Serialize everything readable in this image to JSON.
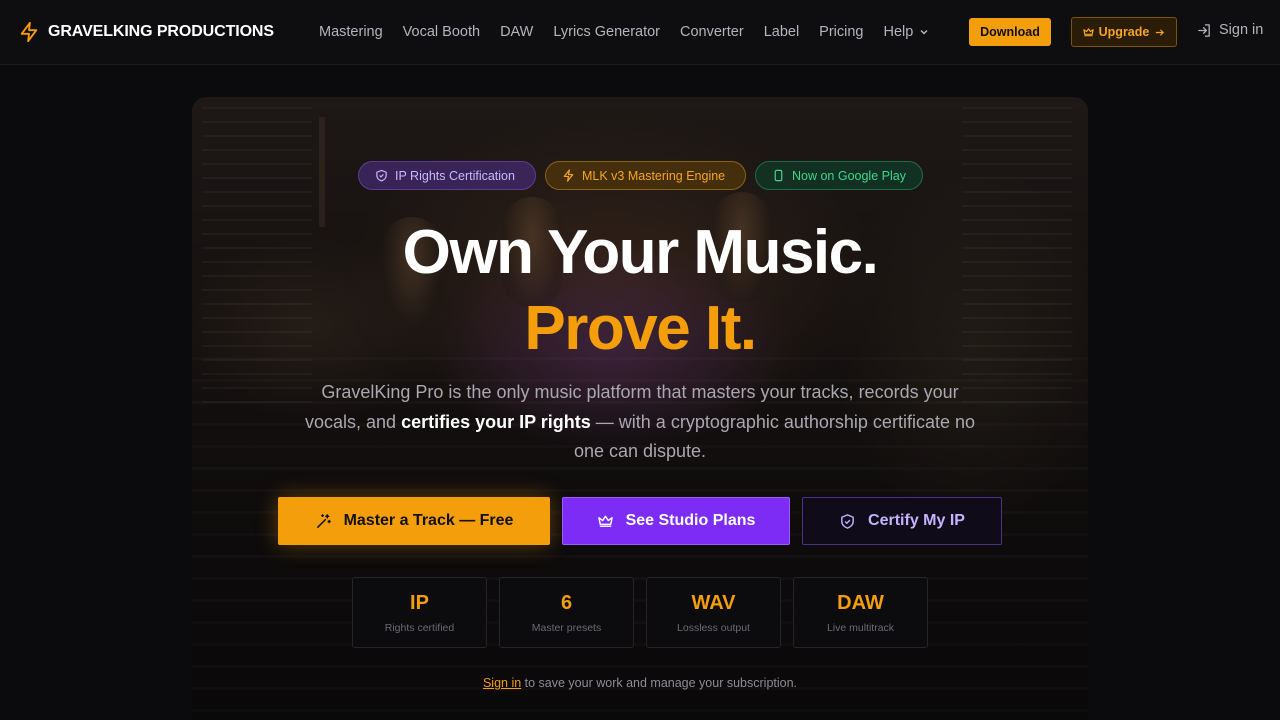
{
  "brand": {
    "name": "GRAVELKING PRODUCTIONS",
    "icon": "lightning-bolt-icon",
    "accent": "#f59e0b"
  },
  "nav": {
    "items": [
      {
        "label": "Mastering"
      },
      {
        "label": "Vocal Booth"
      },
      {
        "label": "DAW"
      },
      {
        "label": "Lyrics Generator"
      },
      {
        "label": "Converter"
      },
      {
        "label": "Label"
      },
      {
        "label": "Pricing"
      },
      {
        "label": "Help"
      }
    ],
    "download_label": "Download",
    "upgrade_label": "Upgrade",
    "signin_label": "Sign in"
  },
  "badges": [
    {
      "label": "IP Rights Certification",
      "icon": "shield-icon",
      "color": "#c9b8ff"
    },
    {
      "label": "MLK v3 Mastering Engine",
      "icon": "lightning-bolt-icon",
      "color": "#f5a524"
    },
    {
      "label": "Now on Google Play",
      "icon": "phone-icon",
      "color": "#3dd68c"
    }
  ],
  "hero": {
    "headline_1": "Own Your Music.",
    "headline_2": "Prove It.",
    "lead_1": "GravelKing Pro is the only music platform that masters your tracks, records your vocals, and ",
    "lead_bold": "certifies your IP rights",
    "lead_2": " — with a cryptographic authorship certificate no one can dispute."
  },
  "cta": {
    "master_label": "Master a Track — Free",
    "plans_label": "See Studio Plans",
    "certify_label": "Certify My IP"
  },
  "stats": [
    {
      "value": "IP",
      "label": "Rights certified"
    },
    {
      "value": "6",
      "label": "Master presets"
    },
    {
      "value": "WAV",
      "label": "Lossless output"
    },
    {
      "value": "DAW",
      "label": "Live multitrack"
    }
  ],
  "footer": {
    "link_label": "Sign in",
    "text": " to save your work and manage your subscription."
  },
  "colors": {
    "orange": "#f59e0b",
    "purple": "#7c2cf5",
    "green": "#3dd68c",
    "lavender": "#c4b2ff"
  }
}
